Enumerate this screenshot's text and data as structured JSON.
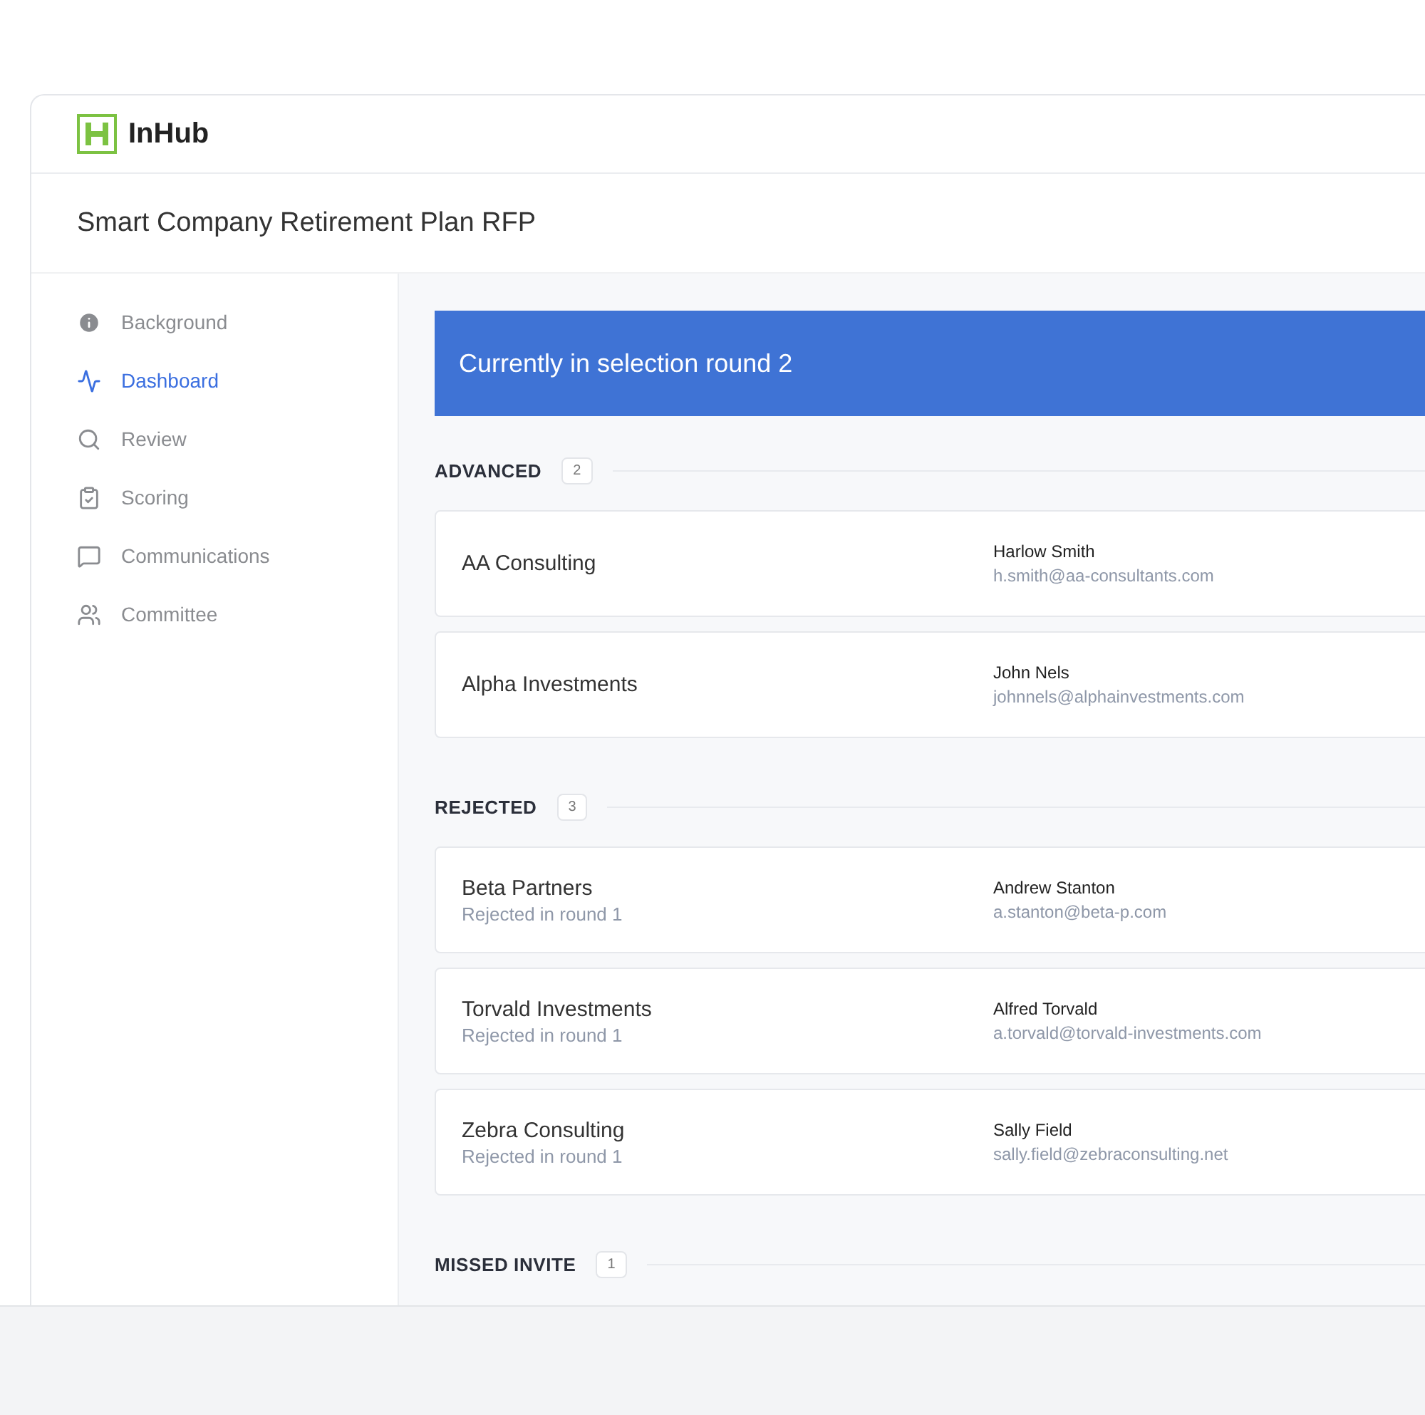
{
  "app": {
    "logo_text": "InHub"
  },
  "page": {
    "title": "Smart Company Retirement Plan RFP"
  },
  "sidebar": {
    "items": [
      {
        "label": "Background",
        "selected": false
      },
      {
        "label": "Dashboard",
        "selected": true
      },
      {
        "label": "Review",
        "selected": false
      },
      {
        "label": "Scoring",
        "selected": false
      },
      {
        "label": "Communications",
        "selected": false
      },
      {
        "label": "Committee",
        "selected": false
      }
    ]
  },
  "banner": {
    "text": "Currently in selection round 2"
  },
  "sections": [
    {
      "title": "ADVANCED",
      "count": "2",
      "vendors": [
        {
          "name": "AA Consulting",
          "contact_name": "Harlow Smith",
          "contact_email": "h.smith@aa-consultants.com"
        },
        {
          "name": "Alpha Investments",
          "contact_name": "John Nels",
          "contact_email": "johnnels@alphainvestments.com"
        }
      ]
    },
    {
      "title": "REJECTED",
      "count": "3",
      "vendors": [
        {
          "name": "Beta Partners",
          "status": "Rejected in round 1",
          "contact_name": "Andrew Stanton",
          "contact_email": "a.stanton@beta-p.com"
        },
        {
          "name": "Torvald Investments",
          "status": "Rejected in round 1",
          "contact_name": "Alfred Torvald",
          "contact_email": "a.torvald@torvald-investments.com"
        },
        {
          "name": "Zebra Consulting",
          "status": "Rejected in round 1",
          "contact_name": "Sally Field",
          "contact_email": "sally.field@zebraconsulting.net"
        }
      ]
    },
    {
      "title": "MISSED INVITE",
      "count": "1"
    }
  ]
}
